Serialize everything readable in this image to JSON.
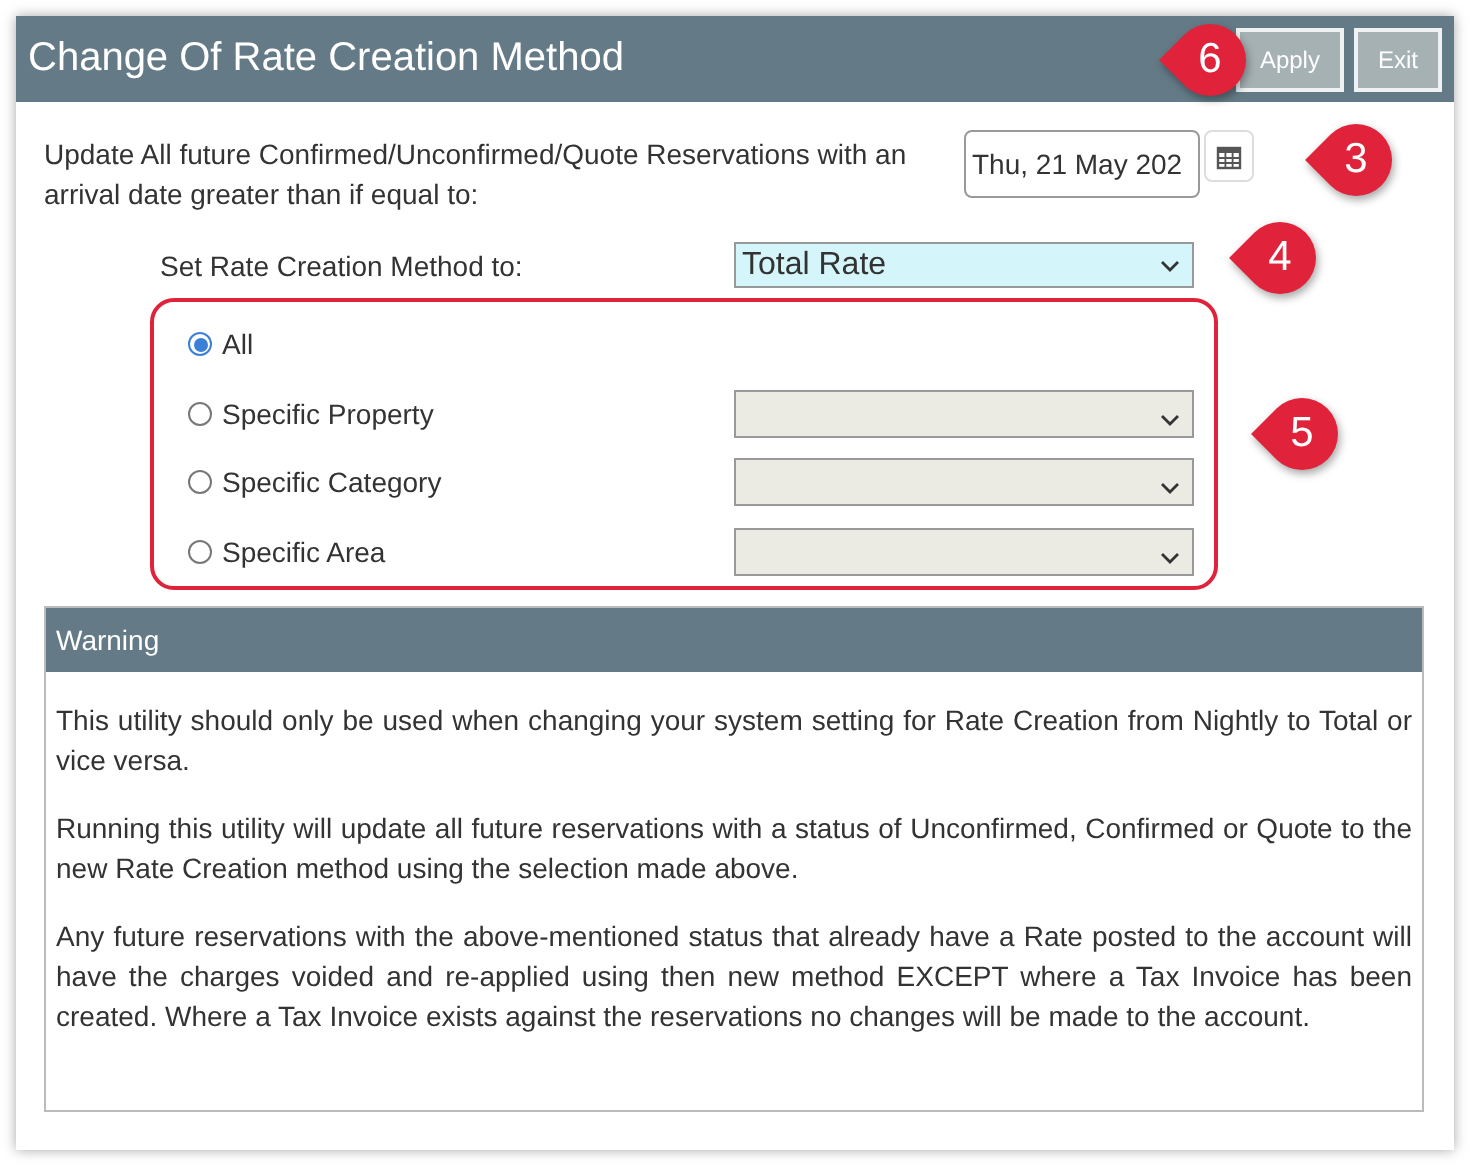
{
  "window": {
    "title": "Change Of Rate Creation Method"
  },
  "toolbar": {
    "callout": "6",
    "buttons": [
      {
        "label": "Apply"
      },
      {
        "label": "Exit"
      }
    ]
  },
  "arrival": {
    "text": "Update All future Confirmed/Unconfirmed/Quote Reservations with an arrival date greater than if equal to:",
    "date_value": "Thu, 21 May 202",
    "callout": "3"
  },
  "rate_method": {
    "label": "Set Rate Creation Method to:",
    "value": "Total Rate",
    "callout": "4"
  },
  "scope": {
    "callout": "5",
    "options": [
      {
        "label": "All",
        "selected": true,
        "kind": "plain"
      },
      {
        "label": "Specific Property",
        "selected": false,
        "kind": "dropdown"
      },
      {
        "label": "Specific Category",
        "selected": false,
        "kind": "dropdown"
      },
      {
        "label": "Specific Area",
        "selected": false,
        "kind": "dropdown"
      }
    ]
  },
  "warning": {
    "title": "Warning",
    "paragraphs": [
      "This utility should only be used when changing your system setting for Rate Creation from Nightly to Total or vice versa.",
      "Running this utility will update all future reservations with a status of Unconfirmed, Confirmed or Quote to the new Rate Creation method using the selection made above.",
      "Any future reservations with the above-mentioned status that already have a Rate posted to the account will have the charges voided and re-applied using then new method EXCEPT where a Tax Invoice has been created. Where a Tax Invoice exists against the reservations no changes will be made to the account."
    ]
  }
}
